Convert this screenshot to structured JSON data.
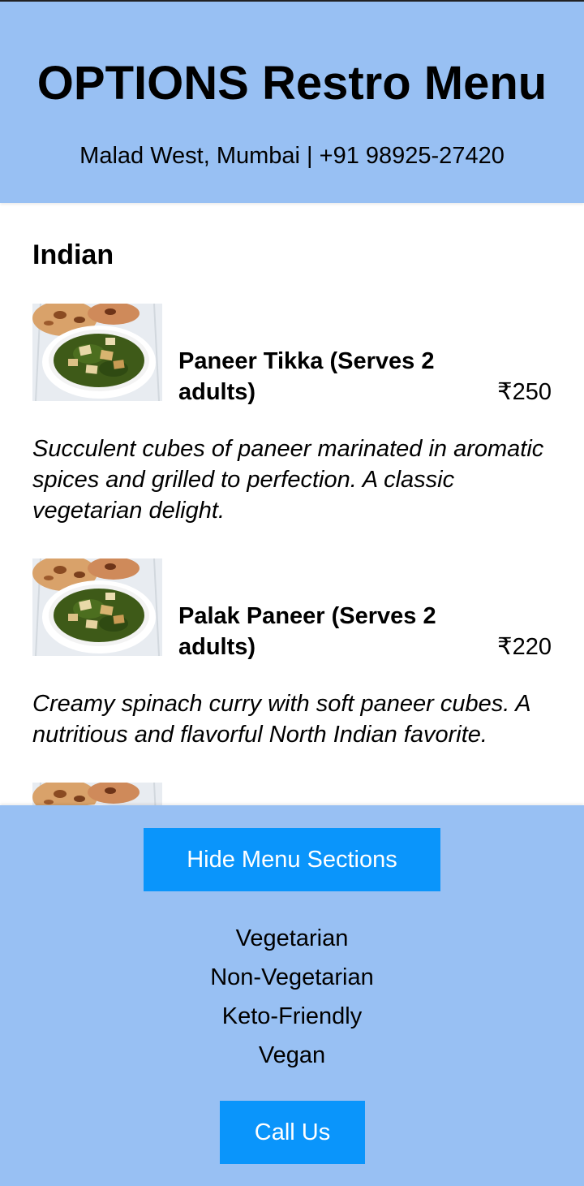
{
  "header": {
    "title": "OPTIONS Restro Menu",
    "subline": "Malad West, Mumbai | +91 98925-27420"
  },
  "menu": {
    "section_title": "Indian",
    "items": [
      {
        "name": "Paneer Tikka (Serves 2 adults)",
        "price": "₹250",
        "description": "Succulent cubes of paneer marinated in aromatic spices and grilled to perfection. A classic vegetarian delight.",
        "image": "palak-paneer-dish-image"
      },
      {
        "name": "Palak Paneer (Serves 2 adults)",
        "price": "₹220",
        "description": "Creamy spinach curry with soft paneer cubes. A nutritious and flavorful North Indian favorite.",
        "image": "palak-paneer-dish-image"
      }
    ]
  },
  "footer": {
    "toggle_label": "Hide Menu Sections",
    "sections": [
      "Vegetarian",
      "Non-Vegetarian",
      "Keto-Friendly",
      "Vegan"
    ],
    "call_label": "Call Us"
  },
  "colors": {
    "header_bg": "#98c0f3",
    "footer_bg": "#98c0f3",
    "button_bg": "#0a95fb",
    "button_text": "#ffffff"
  }
}
